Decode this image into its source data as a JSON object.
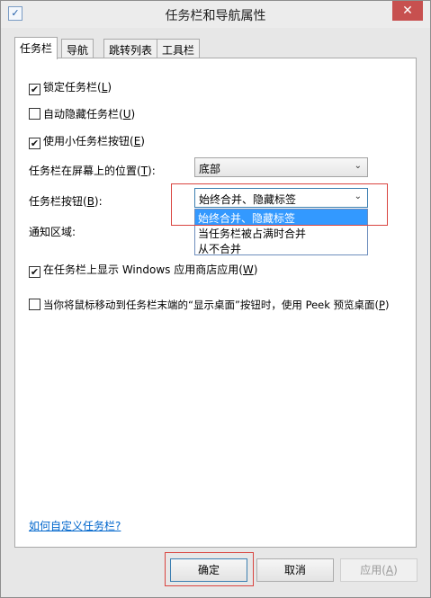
{
  "window": {
    "title": "任务栏和导航属性",
    "close": "✕"
  },
  "tabs": [
    "任务栏",
    "导航",
    "跳转列表",
    "工具栏"
  ],
  "options": {
    "lock_taskbar": {
      "label": "锁定任务栏(",
      "key": "L",
      "end": ")",
      "checked": true
    },
    "auto_hide": {
      "label": "自动隐藏任务栏(",
      "key": "U",
      "end": ")",
      "checked": false
    },
    "small_buttons": {
      "label": "使用小任务栏按钮(",
      "key": "E",
      "end": ")",
      "checked": true
    },
    "show_store_apps": {
      "label": "在任务栏上显示 Windows 应用商店应用(",
      "key": "W",
      "end": ")",
      "checked": true
    },
    "peek": {
      "label": "当你将鼠标移动到任务栏末端的“显示桌面”按钮时，使用 Peek 预览桌面(",
      "key": "P",
      "end": ")",
      "checked": false
    }
  },
  "location": {
    "label": "任务栏在屏幕上的位置(",
    "key": "T",
    "end": "):",
    "value": "底部"
  },
  "buttons_combine": {
    "label": "任务栏按钮(",
    "key": "B",
    "end": "):",
    "value": "始终合并、隐藏标签",
    "dropdown_options": [
      "始终合并、隐藏标签",
      "当任务栏被占满时合并",
      "从不合并"
    ]
  },
  "notification_area": {
    "label": "通知区域:"
  },
  "help_link": "如何自定义任务栏?",
  "footer": {
    "ok": "确定",
    "cancel": "取消",
    "apply": "应用(",
    "apply_key": "A",
    "apply_end": ")"
  },
  "checkmark": "✔",
  "accent_colors": {
    "highlight": "#3399ff",
    "close": "#c7504f",
    "annotation": "#d9443f"
  }
}
